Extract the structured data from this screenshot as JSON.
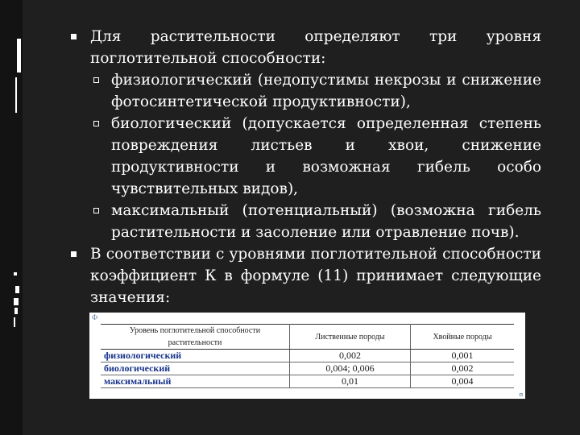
{
  "bullets": {
    "first": "Для растительности определяют три уровня поглотительной способности:",
    "sub": [
      "физиологический (недопустимы некрозы и снижение фотосинтетической продуктивности),",
      "биологический (допускается определенная степень повреждения листьев и хвои, снижение продуктивности и возможная гибель особо чувствительных видов),",
      "максимальный (потенциальный) (возможна гибель растительности и засоление или отравление почв)."
    ],
    "second": "В соответствии с уровнями поглотительной способности коэффициент К в формуле (11) принимает следующие значения:"
  },
  "table": {
    "headers": [
      "Уровень поглотительной способности растительности",
      "Лиственные породы",
      "Хвойные породы"
    ],
    "rows": [
      [
        "физиологический",
        "0,002",
        "0,001"
      ],
      [
        "биологический",
        "0,004; 0,006",
        "0,002"
      ],
      [
        "максимальный",
        "0,01",
        "0,004"
      ]
    ],
    "marker": "Ф",
    "corner": "п"
  },
  "colors": {
    "background": "#1f1f1f",
    "text": "#ffffff",
    "table_level_text": "#17328a"
  }
}
